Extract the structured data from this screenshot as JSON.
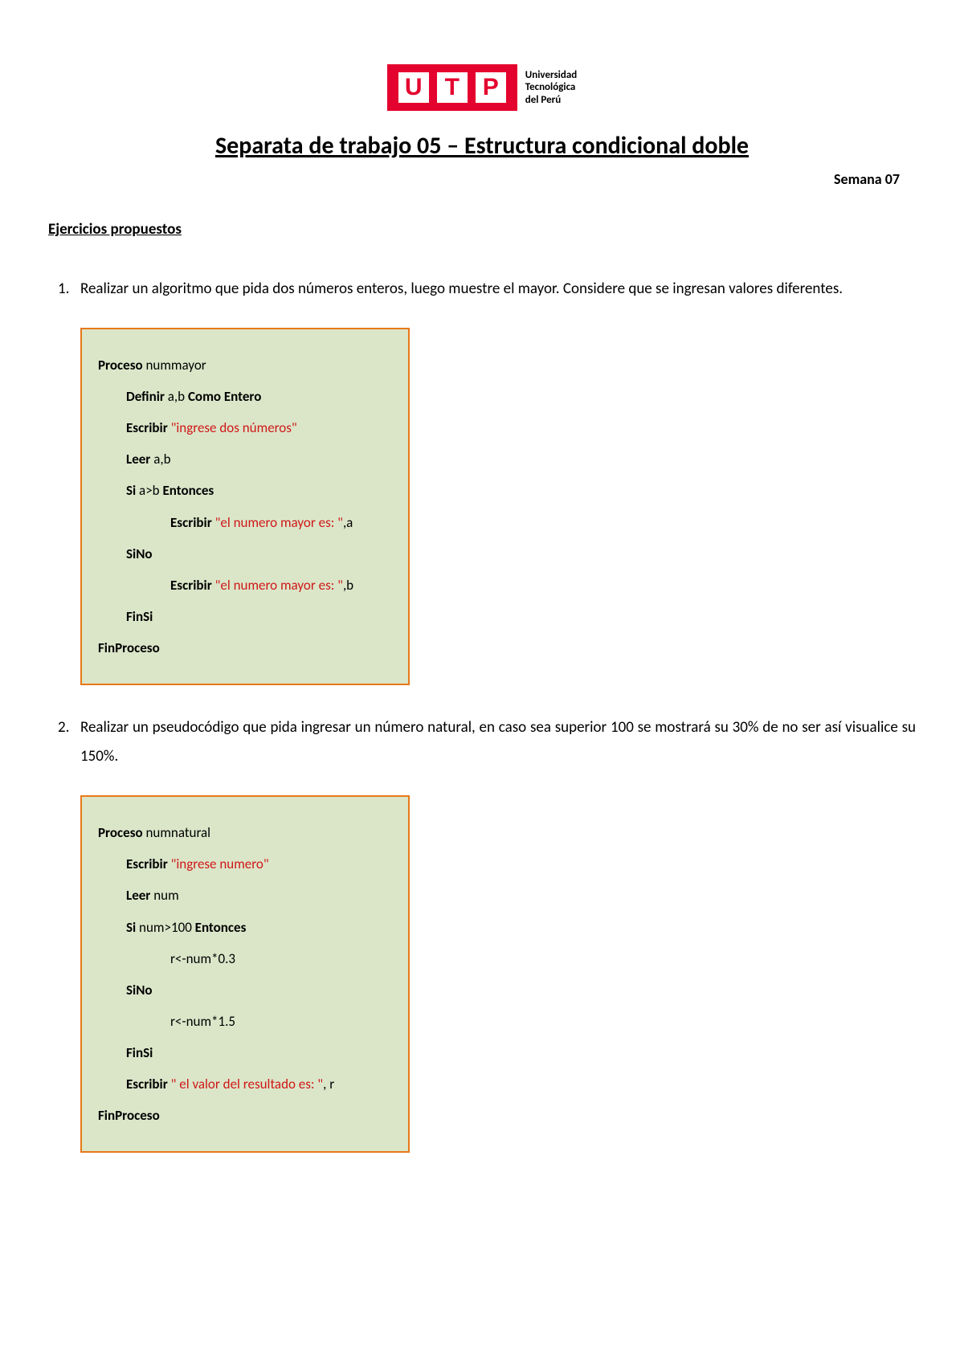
{
  "logo": {
    "letters": [
      "U",
      "T",
      "P"
    ],
    "subtitle_line1": "Universidad",
    "subtitle_line2": "Tecnológica",
    "subtitle_line3": "del Perú"
  },
  "title": "Separata de trabajo 05 – Estructura condicional doble",
  "week": "Semana 07",
  "section_heading": "Ejercicios propuestos",
  "exercises": [
    {
      "number": "1.",
      "text": "Realizar un algoritmo que pida dos números enteros, luego muestre el mayor. Considere que se ingresan valores diferentes.",
      "code": {
        "proc_kw": "Proceso",
        "proc_name": " nummayor",
        "lines": [
          {
            "indent": 1,
            "parts": [
              {
                "kw": true,
                "t": "Definir"
              },
              {
                "t": " a,b "
              },
              {
                "kw": true,
                "t": "Como Entero"
              }
            ]
          },
          {
            "indent": 1,
            "parts": [
              {
                "kw": true,
                "t": "Escribir "
              },
              {
                "str": true,
                "t": "\"ingrese dos números\""
              }
            ]
          },
          {
            "indent": 1,
            "parts": [
              {
                "kw": true,
                "t": "Leer"
              },
              {
                "t": " a,b"
              }
            ]
          },
          {
            "indent": 1,
            "parts": [
              {
                "kw": true,
                "t": "Si"
              },
              {
                "t": " a>b "
              },
              {
                "kw": true,
                "t": "Entonces"
              }
            ]
          },
          {
            "indent": 2,
            "parts": [
              {
                "kw": true,
                "t": "Escribir "
              },
              {
                "str": true,
                "t": "\"el numero mayor es: \""
              },
              {
                "t": ",a"
              }
            ]
          },
          {
            "indent": 1,
            "parts": [
              {
                "kw": true,
                "t": "SiNo"
              }
            ]
          },
          {
            "indent": 2,
            "parts": [
              {
                "kw": true,
                "t": "Escribir "
              },
              {
                "str": true,
                "t": "\"el numero mayor es: \""
              },
              {
                "t": ",b"
              }
            ]
          },
          {
            "indent": 1,
            "parts": [
              {
                "kw": true,
                "t": "FinSi"
              }
            ]
          }
        ],
        "end_kw": "FinProceso"
      }
    },
    {
      "number": "2.",
      "text": "Realizar un pseudocódigo que pida ingresar un número natural, en caso sea superior 100 se mostrará su 30% de no ser así visualice su 150%.",
      "code": {
        "proc_kw": "Proceso",
        "proc_name": " numnatural",
        "lines": [
          {
            "indent": 1,
            "parts": [
              {
                "kw": true,
                "t": "Escribir "
              },
              {
                "str": true,
                "t": "\"ingrese numero\""
              }
            ]
          },
          {
            "indent": 1,
            "parts": [
              {
                "kw": true,
                "t": "Leer"
              },
              {
                "t": " num"
              }
            ]
          },
          {
            "indent": 1,
            "parts": [
              {
                "kw": true,
                "t": "Si"
              },
              {
                "t": " num>100 "
              },
              {
                "kw": true,
                "t": "Entonces"
              }
            ]
          },
          {
            "indent": 2,
            "parts": [
              {
                "t": "r<-num*0.3"
              }
            ]
          },
          {
            "indent": 1,
            "parts": [
              {
                "kw": true,
                "t": "SiNo"
              }
            ]
          },
          {
            "indent": 2,
            "parts": [
              {
                "t": "r<-num*1.5"
              }
            ]
          },
          {
            "indent": 1,
            "parts": [
              {
                "kw": true,
                "t": "FinSi"
              }
            ]
          },
          {
            "indent": 1,
            "parts": [
              {
                "kw": true,
                "t": "Escribir "
              },
              {
                "str": true,
                "t": "\" el valor del resultado es: \""
              },
              {
                "t": ", r"
              }
            ]
          }
        ],
        "end_kw": "FinProceso"
      }
    }
  ]
}
